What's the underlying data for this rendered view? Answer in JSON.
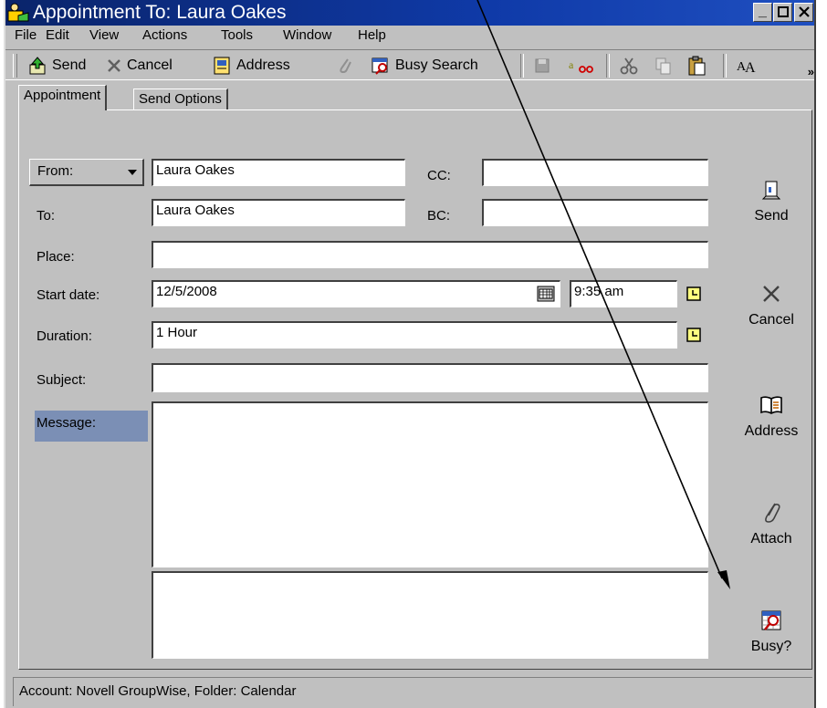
{
  "window": {
    "title": "Appointment To: Laura Oakes"
  },
  "menu": [
    "File",
    "Edit",
    "View",
    "Actions",
    "Tools",
    "Window",
    "Help"
  ],
  "toolbar": {
    "send": "Send",
    "cancel": "Cancel",
    "address": "Address",
    "busy_search": "Busy Search",
    "overflow": "»"
  },
  "tabs": {
    "appointment": "Appointment",
    "send_options": "Send Options"
  },
  "form": {
    "from_label": "From:",
    "from_value": "Laura Oakes",
    "cc_label": "CC:",
    "cc_value": "",
    "to_label": "To:",
    "to_value": "Laura Oakes",
    "bc_label": "BC:",
    "bc_value": "",
    "place_label": "Place:",
    "place_value": "",
    "start_label": "Start date:",
    "start_date": "12/5/2008",
    "start_time": "9:35 am",
    "duration_label": "Duration:",
    "duration_value": "1 Hour",
    "subject_label": "Subject:",
    "subject_value": "",
    "message_label": "Message:"
  },
  "side": {
    "send": "Send",
    "cancel": "Cancel",
    "address": "Address",
    "attach": "Attach",
    "busy": "Busy?"
  },
  "status": "Account: Novell GroupWise,  Folder: Calendar",
  "colors": {
    "titlebar": "#0a246a",
    "chrome": "#c0c0c0",
    "message_highlight": "#7b8fb5"
  }
}
